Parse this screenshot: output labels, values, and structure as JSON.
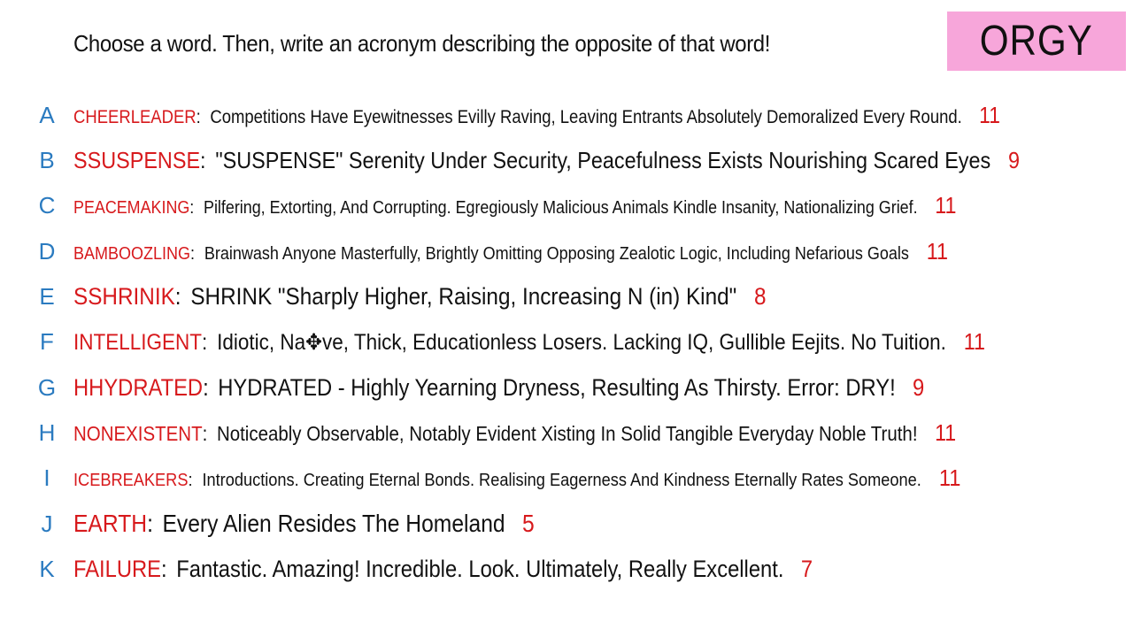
{
  "prompt": "Choose a word. Then, write an acronym describing the opposite of that word!",
  "badge": "ORGY",
  "colors": {
    "letter": "#2b7bc0",
    "word": "#d7191c",
    "score": "#d7191c",
    "badge_bg": "#f7a6da",
    "text": "#111111"
  },
  "entries": [
    {
      "letter": "A",
      "word": "CHEERLEADER",
      "colon": ":",
      "answer": "Competitions Have Eyewitnesses Evilly Raving, Leaving Entrants Absolutely Demoralized Every Round.",
      "score": "11"
    },
    {
      "letter": "B",
      "word": "SSUSPENSE",
      "colon": ":",
      "answer": "\"SUSPENSE\" Serenity Under Security, Peacefulness Exists Nourishing Scared Eyes",
      "score": "9"
    },
    {
      "letter": "C",
      "word": "PEACEMAKING",
      "colon": ":",
      "answer": "Pilfering, Extorting, And Corrupting. Egregiously Malicious Animals Kindle Insanity, Nationalizing Grief.",
      "score": "11"
    },
    {
      "letter": "D",
      "word": "BAMBOOZLING",
      "colon": ":",
      "answer": "Brainwash Anyone Masterfully, Brightly Omitting Opposing Zealotic Logic, Including Nefarious Goals",
      "score": "11"
    },
    {
      "letter": "E",
      "word": "SSHRINIK",
      "colon": ":",
      "answer": "SHRINK \"Sharply Higher, Raising, Increasing N (in) Kind\"",
      "score": "8"
    },
    {
      "letter": "F",
      "word": "INTELLIGENT",
      "colon": ":",
      "answer": "Idiotic, Na✥ve, Thick, Educationless Losers. Lacking IQ, Gullible Eejits. No Tuition.",
      "score": "11"
    },
    {
      "letter": "G",
      "word": "HHYDRATED",
      "colon": ":",
      "answer": "HYDRATED - Highly Yearning Dryness, Resulting As Thirsty. Error: DRY!",
      "score": "9"
    },
    {
      "letter": "H",
      "word": "NONEXISTENT",
      "colon": ":",
      "answer": "Noticeably Observable, Notably Evident Xisting In Solid Tangible Everyday Noble Truth!",
      "score": "11"
    },
    {
      "letter": "I",
      "word": "ICEBREAKERS",
      "colon": ":",
      "answer": "Introductions. Creating Eternal Bonds. Realising Eagerness And Kindness Eternally Rates Someone.",
      "score": "11"
    },
    {
      "letter": "J",
      "word": "EARTH",
      "colon": ":",
      "answer": "Every Alien Resides The Homeland",
      "score": "5"
    },
    {
      "letter": "K",
      "word": "FAILURE",
      "colon": ":",
      "answer": "Fantastic. Amazing! Incredible. Look. Ultimately, Really Excellent.",
      "score": "7"
    }
  ]
}
